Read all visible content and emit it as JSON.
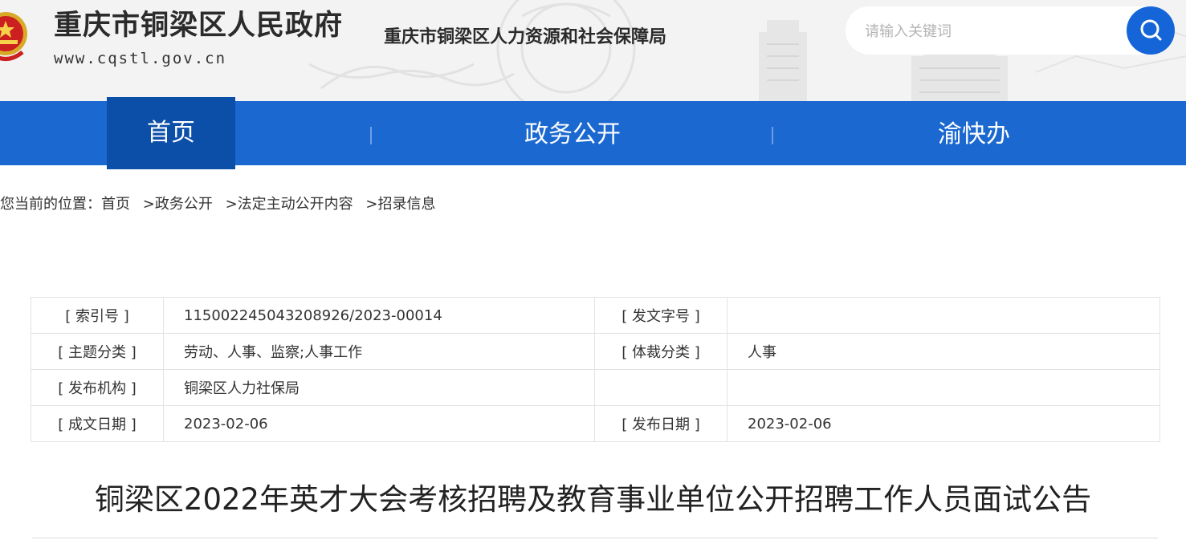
{
  "header": {
    "site_title": "重庆市铜梁区人民政府",
    "site_url": "www.cqstl.gov.cn",
    "dept_name": "重庆市铜梁区人力资源和社会保障局",
    "search_placeholder": "请输入关键词",
    "search_icon": "search-icon",
    "emblem_icon": "national-emblem-icon"
  },
  "nav": {
    "items": [
      {
        "label": "首页",
        "active": true
      },
      {
        "label": "政务公开",
        "active": false
      },
      {
        "label": "渝快办",
        "active": false
      }
    ]
  },
  "breadcrumb": {
    "prefix": "您当前的位置：",
    "items": [
      "首页",
      "政务公开",
      "法定主动公开内容",
      "招录信息"
    ],
    "separator": ">"
  },
  "info": {
    "rows": [
      {
        "label1": "[ 索引号 ]",
        "value1": "115002245043208926/2023-00014",
        "label2": "[ 发文字号 ]",
        "value2": ""
      },
      {
        "label1": "[ 主题分类 ]",
        "value1": "劳动、人事、监察;人事工作",
        "label2": "[ 体裁分类 ]",
        "value2": "人事"
      },
      {
        "label1": "[ 发布机构 ]",
        "value1": "铜梁区人力社保局",
        "label2": "",
        "value2": ""
      },
      {
        "label1": "[ 成文日期 ]",
        "value1": "2023-02-06",
        "label2": "[ 发布日期 ]",
        "value2": "2023-02-06"
      }
    ]
  },
  "article": {
    "title": "铜梁区2022年英才大会考核招聘及教育事业单位公开招聘工作人员面试公告"
  },
  "colors": {
    "nav_bg": "#1a68d0",
    "nav_active_bg": "#0c4fa8",
    "search_button": "#1565d8",
    "header_bg": "#f3f3f3"
  }
}
